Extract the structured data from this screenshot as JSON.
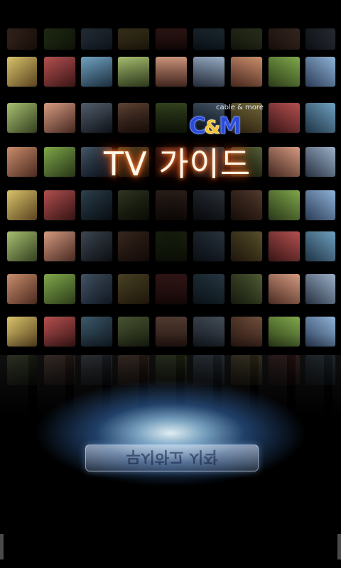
{
  "app": {
    "logo_tagline": "cable & more",
    "logo_c": "C",
    "logo_amp": "&",
    "logo_m": "M",
    "title": "TV 가이드"
  },
  "start_button": {
    "label": "무시하고 시작"
  },
  "colors": {
    "background": "#000000",
    "title_glow": "#ff6a1f",
    "logo_blue": "#2b4bd8",
    "logo_amp": "#f1c232",
    "spotlight": "#8fd2ff"
  },
  "thumbnail_icons": [
    "tv-thumbnail"
  ]
}
